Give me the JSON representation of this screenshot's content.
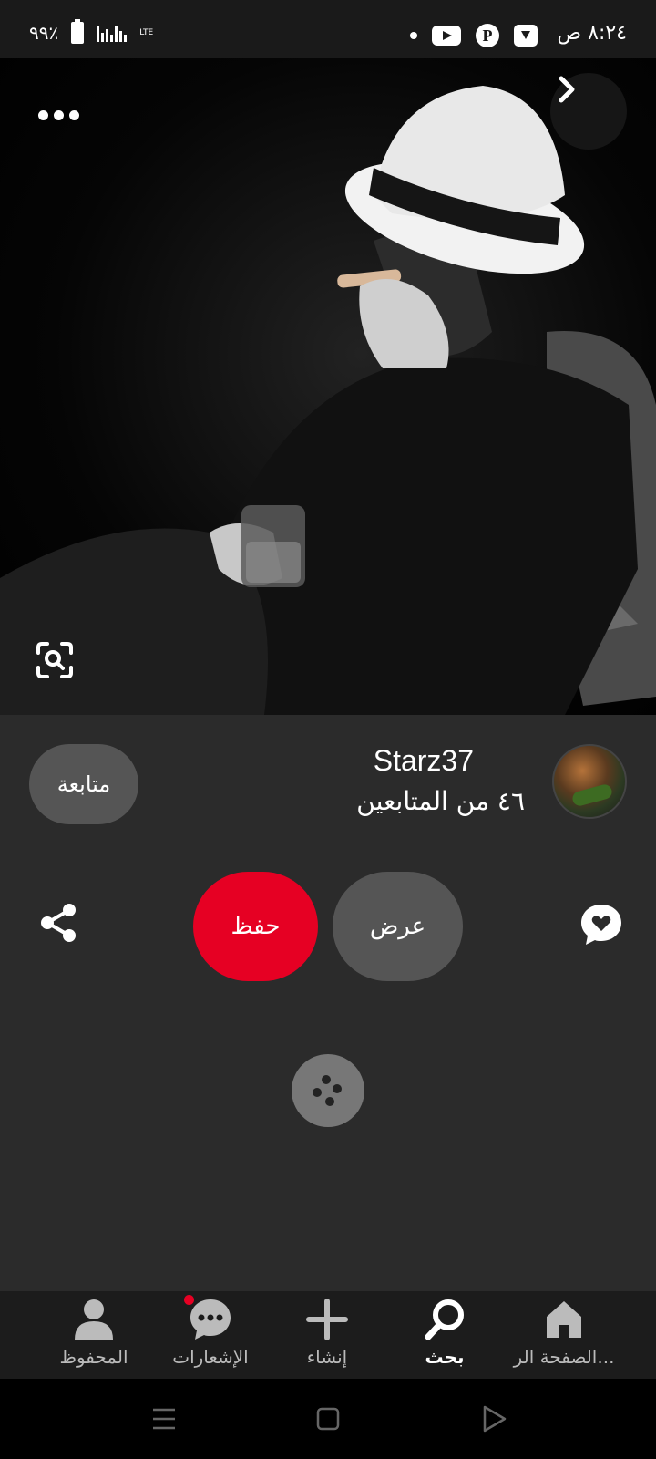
{
  "status_bar": {
    "time": "٨:٢٤ ص",
    "battery": "٩٩٪",
    "network": "LTE"
  },
  "pin": {
    "image_icon_names": [
      "more-icon",
      "chevron-right-icon",
      "visual-search-icon"
    ]
  },
  "creator": {
    "name": "Starz37",
    "followers": "٤٦ من المتابعين",
    "follow_label": "متابعة"
  },
  "actions": {
    "save_label": "حفظ",
    "view_label": "عرض",
    "share_icon": "share-icon",
    "comment_icon": "comment-heart-icon"
  },
  "bottom_nav": {
    "items": [
      {
        "label": "الصفحة الر...",
        "icon": "home-icon"
      },
      {
        "label": "بحث",
        "icon": "search-icon",
        "active": true
      },
      {
        "label": "إنشاء",
        "icon": "plus-icon"
      },
      {
        "label": "الإشعارات",
        "icon": "chat-bubble-icon"
      },
      {
        "label": "المحفوظ",
        "icon": "person-icon"
      }
    ]
  },
  "colors": {
    "brand": "#e60023",
    "background": "#2b2b2b",
    "pill": "#555555"
  }
}
